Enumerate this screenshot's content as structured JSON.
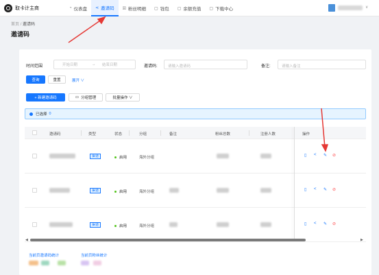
{
  "app": {
    "title": "取卡计主商"
  },
  "nav": {
    "items": [
      {
        "icon": "dashboard-icon",
        "glyph": "◔",
        "label": "仪表盘"
      },
      {
        "icon": "share-icon",
        "glyph": "⋖",
        "label": "邀请码"
      },
      {
        "icon": "list-icon",
        "glyph": "☒",
        "label": "粉丝明细"
      },
      {
        "icon": "wallet-icon",
        "glyph": "▢",
        "label": "钱包"
      },
      {
        "icon": "recharge-icon",
        "glyph": "▢",
        "label": "余额充值"
      },
      {
        "icon": "download-icon",
        "glyph": "▢",
        "label": "下载中心"
      }
    ],
    "active_index": 1
  },
  "breadcrumb": {
    "home": "首页",
    "sep": "/",
    "current": "邀请码"
  },
  "page_title": "邀请码",
  "filters": {
    "time_label": "时间范围",
    "start_placeholder": "开始日期",
    "range_sep": "→",
    "end_placeholder": "结束日期",
    "code_label": "邀请码:",
    "code_placeholder": "请输入邀请码",
    "remark_label": "备注:",
    "remark_placeholder": "请输入备注",
    "query_button": "查询",
    "reset_button": "重置",
    "expand_link": "展开 ∨"
  },
  "toolbar": {
    "add_button": "+ 新建邀请码",
    "group_button": "分组管理",
    "batch_button": "批量操作 ∨"
  },
  "selection": {
    "label": "已选择",
    "count": "0"
  },
  "table": {
    "columns": [
      "邀请码",
      "类型",
      "状态",
      "分组",
      "备注",
      "粉丝总数",
      "注册人数",
      "操作"
    ],
    "rows": [
      {
        "type": "渠道",
        "status": "启用",
        "group": "海外分组"
      },
      {
        "type": "渠道",
        "status": "启用",
        "group": "海外分组"
      },
      {
        "type": "渠道",
        "status": "启用",
        "group": "海外分组"
      }
    ],
    "actions": [
      {
        "name": "view-icon",
        "glyph": "▯"
      },
      {
        "name": "share-icon",
        "glyph": "<"
      },
      {
        "name": "edit-icon",
        "glyph": "✎"
      },
      {
        "name": "disable-icon",
        "glyph": "⊘"
      }
    ],
    "scroll_position_percent": 0
  },
  "stats": {
    "invite_label": "当前页邀请码统计",
    "fans_label": "当前页粉丝统计"
  }
}
